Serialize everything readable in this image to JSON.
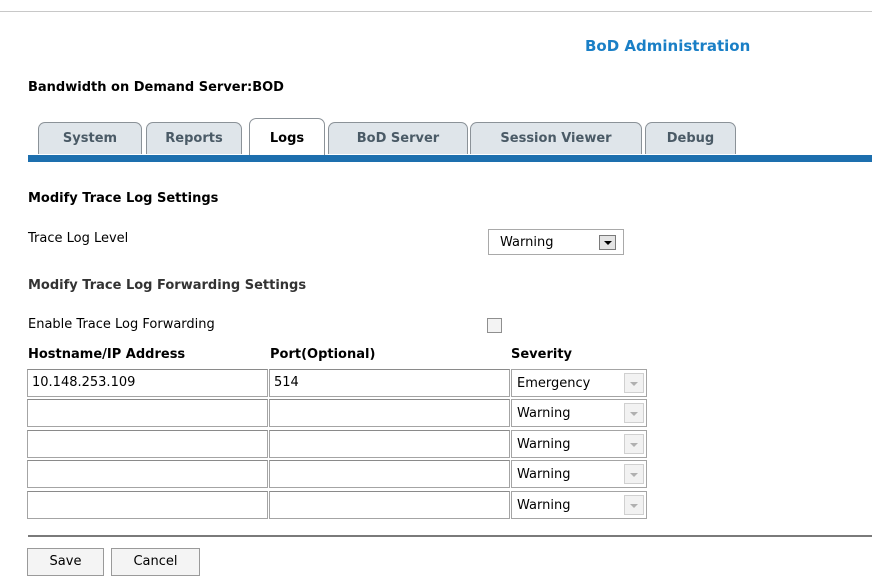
{
  "header": {
    "app_title": "BoD Administration",
    "server_title": "Bandwidth on Demand Server:BOD"
  },
  "tabs": [
    {
      "label": "System",
      "active": false
    },
    {
      "label": "Reports",
      "active": false
    },
    {
      "label": "Logs",
      "active": true
    },
    {
      "label": "BoD Server",
      "active": false
    },
    {
      "label": "Session Viewer",
      "active": false
    },
    {
      "label": "Debug",
      "active": false
    }
  ],
  "trace": {
    "heading": "Modify Trace Log Settings",
    "level_label": "Trace Log Level",
    "level_value": "Warning"
  },
  "forwarding": {
    "heading": "Modify Trace Log Forwarding Settings",
    "enable_label": "Enable Trace Log Forwarding",
    "enabled": false,
    "columns": {
      "host": "Hostname/IP Address",
      "port": "Port(Optional)",
      "severity": "Severity"
    },
    "rows": [
      {
        "host": "10.148.253.109",
        "port": "514",
        "severity": "Emergency"
      },
      {
        "host": "",
        "port": "",
        "severity": "Warning"
      },
      {
        "host": "",
        "port": "",
        "severity": "Warning"
      },
      {
        "host": "",
        "port": "",
        "severity": "Warning"
      },
      {
        "host": "",
        "port": "",
        "severity": "Warning"
      }
    ]
  },
  "actions": {
    "save": "Save",
    "cancel": "Cancel"
  },
  "colors": {
    "accent": "#1a7fc6",
    "tab_bar": "#1d6fae"
  }
}
